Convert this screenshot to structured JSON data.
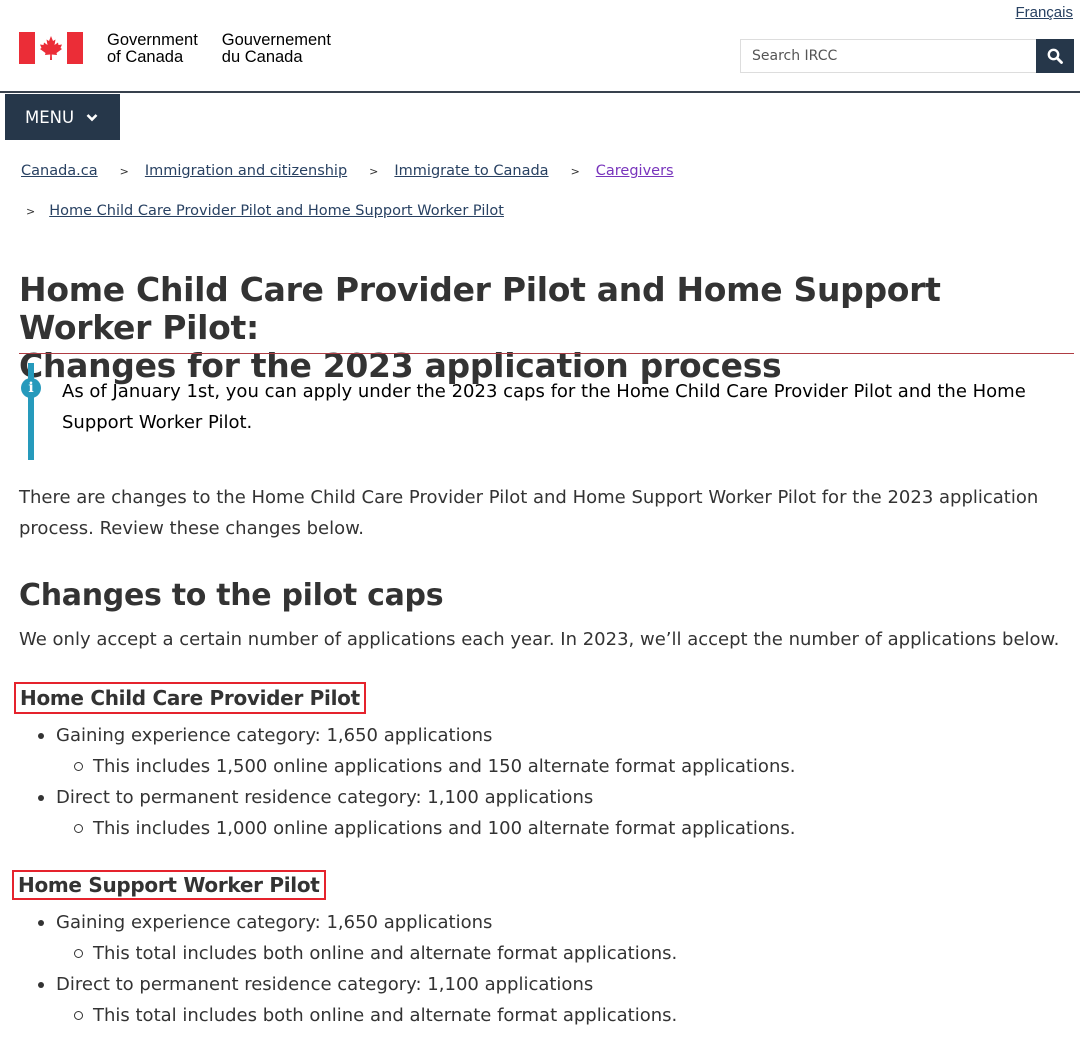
{
  "header": {
    "language_link": "Français",
    "signature_en_line1": "Government",
    "signature_en_line2": "of Canada",
    "signature_fr_line1": "Gouvernement",
    "signature_fr_line2": "du Canada",
    "search_placeholder": "Search IRCC",
    "search_button_icon": "search-icon",
    "menu_label": "MENU"
  },
  "breadcrumb": [
    {
      "label": "Canada.ca"
    },
    {
      "label": "Immigration and citizenship"
    },
    {
      "label": "Immigrate to Canada"
    },
    {
      "label": "Caregivers"
    },
    {
      "label": "Home Child Care Provider Pilot and Home Support Worker Pilot"
    }
  ],
  "page": {
    "title_line1": "Home Child Care Provider Pilot and Home Support Worker Pilot:",
    "title_line2": "Changes for the 2023 application process",
    "alert_text": "As of January 1st, you can apply under the 2023 caps for the Home Child Care Provider Pilot and the Home Support Worker Pilot.",
    "intro": "There are changes to the Home Child Care Provider Pilot and Home Support Worker Pilot for the 2023 application process. Review these changes below.",
    "section_heading": "Changes to the pilot caps",
    "section_lead": "We only accept a certain number of applications each year. In 2023, we’ll accept the number of applications below."
  },
  "pilots": [
    {
      "heading": "Home Child Care Provider Pilot",
      "items": [
        {
          "text": "Gaining experience category: 1,650 applications",
          "sub": "This includes 1,500 online applications and 150 alternate format applications."
        },
        {
          "text": "Direct to permanent residence category: 1,100 applications",
          "sub": "This includes 1,000 online applications and 100 alternate format applications."
        }
      ]
    },
    {
      "heading": "Home Support Worker Pilot",
      "items": [
        {
          "text": "Gaining experience category: 1,650 applications",
          "sub": "This total includes both online and alternate format applications."
        },
        {
          "text": "Direct to permanent residence category: 1,100 applications",
          "sub": "This total includes both online and alternate format applications."
        }
      ]
    }
  ],
  "colors": {
    "header_dark": "#26374a",
    "flag_red": "#eb2d37",
    "alert_blue": "#269abc",
    "highlight_red": "#e5232d",
    "visited_link": "#7834bc"
  }
}
